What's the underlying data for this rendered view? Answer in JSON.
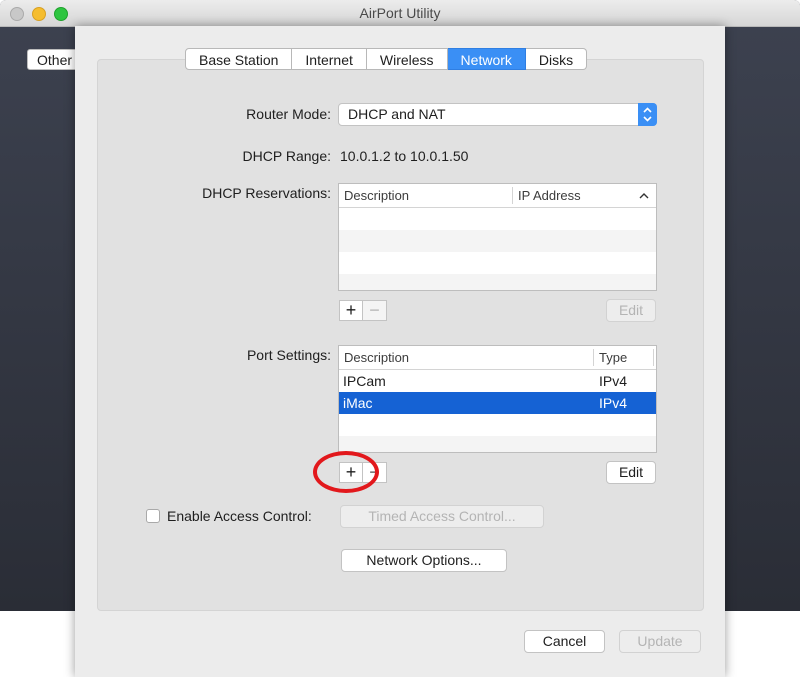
{
  "window": {
    "title": "AirPort Utility"
  },
  "background": {
    "other_button": "Other"
  },
  "tabs": [
    {
      "label": "Base Station",
      "active": false
    },
    {
      "label": "Internet",
      "active": false
    },
    {
      "label": "Wireless",
      "active": false
    },
    {
      "label": "Network",
      "active": true
    },
    {
      "label": "Disks",
      "active": false
    }
  ],
  "router_mode": {
    "label": "Router Mode:",
    "value": "DHCP and NAT"
  },
  "dhcp_range": {
    "label": "DHCP Range:",
    "value": "10.0.1.2 to 10.0.1.50"
  },
  "dhcp_reservations": {
    "label": "DHCP Reservations:",
    "columns": [
      "Description",
      "IP Address"
    ],
    "rows": [],
    "add_label": "+",
    "remove_label": "−",
    "edit_label": "Edit"
  },
  "port_settings": {
    "label": "Port Settings:",
    "columns": [
      "Description",
      "Type"
    ],
    "rows": [
      {
        "description": "IPCam",
        "type": "IPv4",
        "selected": false
      },
      {
        "description": "iMac",
        "type": "IPv4",
        "selected": true
      }
    ],
    "add_label": "+",
    "remove_label": "−",
    "edit_label": "Edit"
  },
  "access_control": {
    "checkbox_label": "Enable Access Control:",
    "checked": false,
    "timed_button": "Timed Access Control..."
  },
  "network_options_button": "Network Options...",
  "footer": {
    "cancel": "Cancel",
    "update": "Update"
  },
  "colors": {
    "accent": "#3a8ff5",
    "selection": "#1562d4",
    "annotation": "#e2181c"
  }
}
